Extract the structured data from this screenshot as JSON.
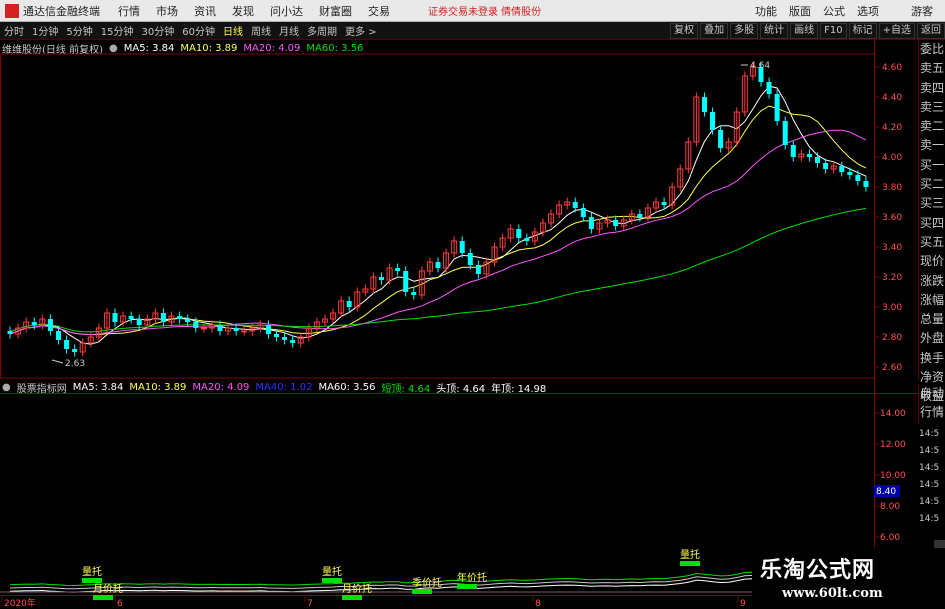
{
  "menubar": {
    "app_title": "通达信金融终端",
    "items": [
      "行情",
      "市场",
      "资讯",
      "发现",
      "问小达",
      "财富圈",
      "交易"
    ],
    "notice": "证券交易未登录  倩倩股份",
    "right_items": [
      "功能",
      "版面",
      "公式",
      "选项",
      "游客"
    ]
  },
  "toolbar": {
    "periods": [
      "分时",
      "1分钟",
      "5分钟",
      "15分钟",
      "30分钟",
      "60分钟",
      "日线",
      "周线",
      "月线",
      "多周期",
      "更多 >"
    ],
    "active_period": "日线",
    "right_buttons": [
      "复权",
      "叠加",
      "多股",
      "统计",
      "画线",
      "F10",
      "标记",
      "+自选",
      "返回"
    ]
  },
  "main_chart": {
    "title": "维维股份(日线 前复权)",
    "ma_labels": [
      {
        "text": "MA5: 3.84",
        "color": "#ffffff"
      },
      {
        "text": "MA10: 3.89",
        "color": "#ffff54"
      },
      {
        "text": "MA20: 4.09",
        "color": "#ff54ff"
      },
      {
        "text": "MA60: 3.56",
        "color": "#00e000"
      }
    ],
    "price_ticks": [
      "4.60",
      "4.40",
      "4.20",
      "4.00",
      "3.80",
      "3.60",
      "3.40",
      "3.20",
      "3.00",
      "2.80",
      "2.60"
    ],
    "high_label": "4.64",
    "low_label": "2.63"
  },
  "indicator": {
    "title": "股票指标网",
    "labels": [
      {
        "text": "MA5: 3.84",
        "color": "#ffffff"
      },
      {
        "text": "MA10: 3.89",
        "color": "#ffff54"
      },
      {
        "text": "MA20: 4.09",
        "color": "#ff54ff"
      },
      {
        "text": "MA40: 1.02",
        "color": "#3030ff"
      },
      {
        "text": "MA60: 3.56",
        "color": "#ffffff"
      },
      {
        "text": "短顶: 4.64",
        "color": "#00e000"
      },
      {
        "text": "头顶: 4.64",
        "color": "#ffffff"
      },
      {
        "text": "年顶: 14.98",
        "color": "#ffffff"
      }
    ],
    "ticks": [
      "14.00",
      "12.00",
      "10.00",
      "8.00",
      "6.00"
    ],
    "current_value": "8.40",
    "signals": [
      "量托",
      "月价托",
      "量托",
      "月价托",
      "季价托",
      "年价托",
      "量托"
    ]
  },
  "date_axis": [
    "2020年",
    "6",
    "7",
    "8",
    "9"
  ],
  "side_panel": {
    "items": [
      "委比",
      "卖五",
      "卖四",
      "卖三",
      "卖二",
      "卖一",
      "买一",
      "买二",
      "买三",
      "买四",
      "买五",
      "现价",
      "涨跌",
      "涨幅",
      "总量",
      "外盘",
      "换手",
      "净资",
      "收益"
    ],
    "lower_items": [
      "自动",
      "行情"
    ],
    "times": [
      "14:5",
      "14:5",
      "14:5",
      "14:5",
      "14:5",
      "14:5"
    ]
  },
  "watermark": {
    "cn": "乐淘公式网",
    "url": "www.60lt.com"
  },
  "colors": {
    "up": "#ff3c3c",
    "down": "#00ffff",
    "ma5": "#ffffff",
    "ma10": "#ffff54",
    "ma20": "#ff54ff",
    "ma60": "#00e000",
    "grid": "#7a0000"
  }
}
